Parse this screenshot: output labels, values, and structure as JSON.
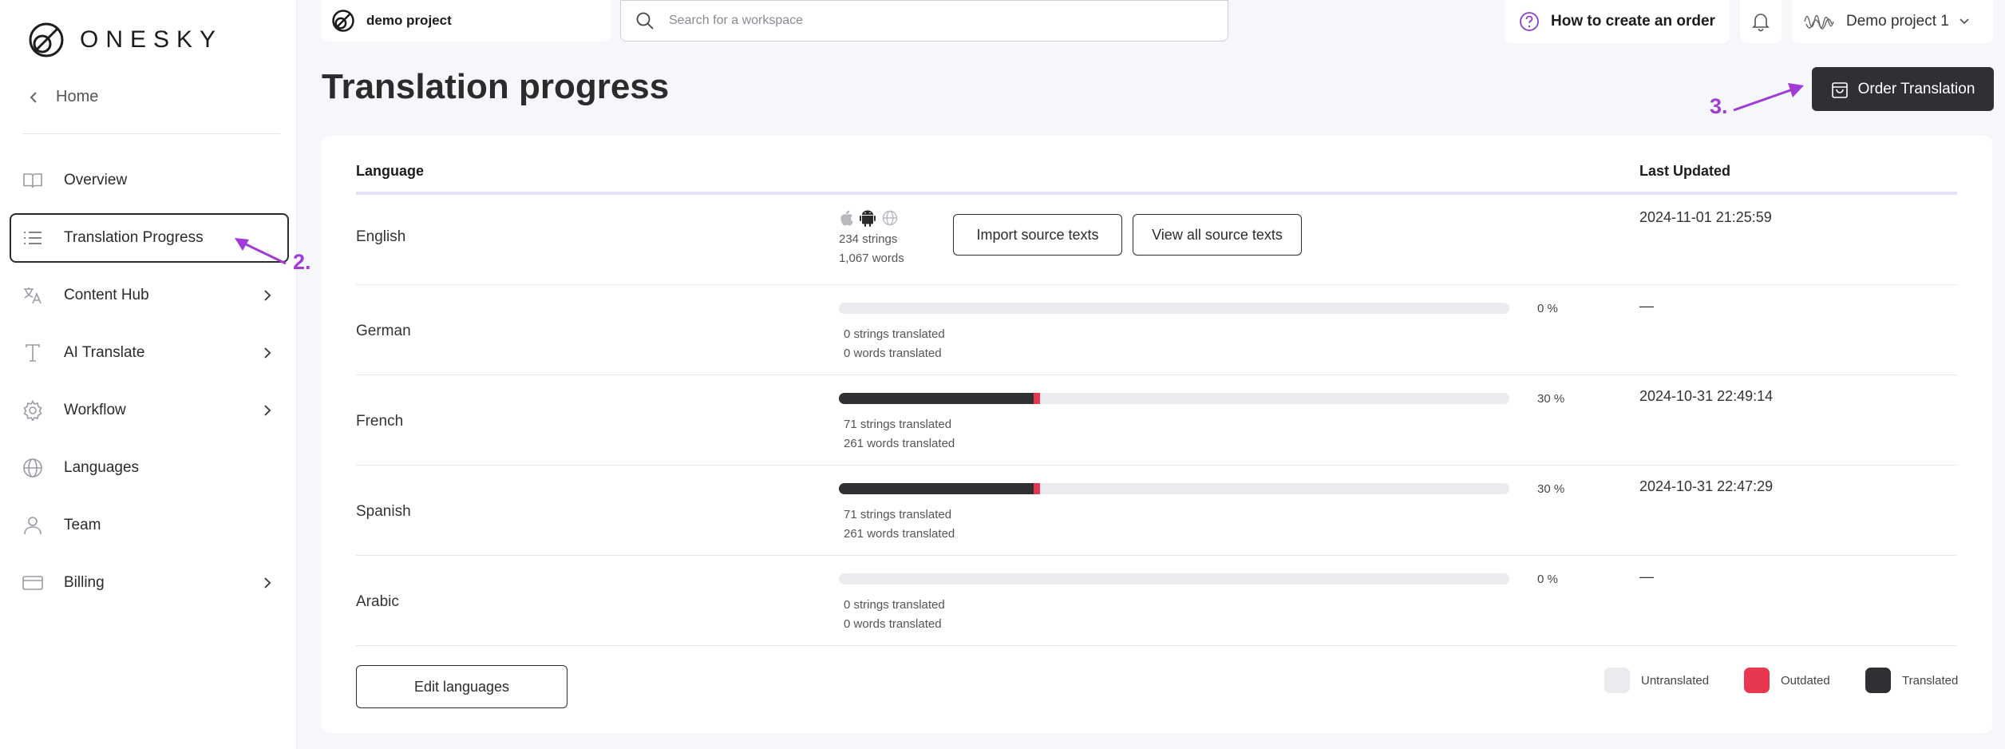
{
  "brand": {
    "logo_text": "ONESKY"
  },
  "sidebar": {
    "home_label": "Home",
    "items": [
      {
        "label": "Overview",
        "icon": "book-icon",
        "has_chevron": false
      },
      {
        "label": "Translation Progress",
        "icon": "list-icon",
        "active": true,
        "has_chevron": false
      },
      {
        "label": "Content Hub",
        "icon": "translate-icon",
        "has_chevron": true
      },
      {
        "label": "AI Translate",
        "icon": "text-icon",
        "has_chevron": true
      },
      {
        "label": "Workflow",
        "icon": "gear-icon",
        "has_chevron": true
      },
      {
        "label": "Languages",
        "icon": "globe-icon",
        "has_chevron": false
      },
      {
        "label": "Team",
        "icon": "user-icon",
        "has_chevron": false
      },
      {
        "label": "Billing",
        "icon": "card-icon",
        "has_chevron": true
      }
    ]
  },
  "topbar": {
    "project_name": "demo project",
    "search_placeholder": "Search for a workspace",
    "howto_label": "How to create an order",
    "user_project": "Demo project 1"
  },
  "page": {
    "title": "Translation progress",
    "order_button": "Order Translation"
  },
  "annotations": {
    "step2": "2.",
    "step3": "3.",
    "color": "#a13bd6"
  },
  "table": {
    "col_language": "Language",
    "col_updated": "Last Updated",
    "source": {
      "language": "English",
      "strings": "234 strings",
      "words": "1,067 words",
      "import_button": "Import source texts",
      "view_button": "View all source texts",
      "updated": "2024-11-01 21:25:59",
      "platform_icons": [
        "apple-icon",
        "android-icon",
        "web-globe-icon"
      ]
    },
    "rows": [
      {
        "language": "German",
        "progress": 0,
        "outdated": 0,
        "pct_label": "0 %",
        "strings": "0 strings translated",
        "words": "0 words translated",
        "updated": "—"
      },
      {
        "language": "French",
        "progress": 0.29,
        "outdated": 0.01,
        "pct_label": "30 %",
        "strings": "71 strings translated",
        "words": "261 words translated",
        "updated": "2024-10-31 22:49:14"
      },
      {
        "language": "Spanish",
        "progress": 0.29,
        "outdated": 0.01,
        "pct_label": "30 %",
        "strings": "71 strings translated",
        "words": "261 words translated",
        "updated": "2024-10-31 22:47:29"
      },
      {
        "language": "Arabic",
        "progress": 0,
        "outdated": 0,
        "pct_label": "0 %",
        "strings": "0 strings translated",
        "words": "0 words translated",
        "updated": "—"
      }
    ],
    "edit_languages": "Edit languages"
  },
  "legend": {
    "untranslated": "Untranslated",
    "outdated": "Outdated",
    "translated": "Translated",
    "colors": {
      "untranslated": "#ebebef",
      "outdated": "#e8384f",
      "translated": "#2f3033"
    }
  }
}
